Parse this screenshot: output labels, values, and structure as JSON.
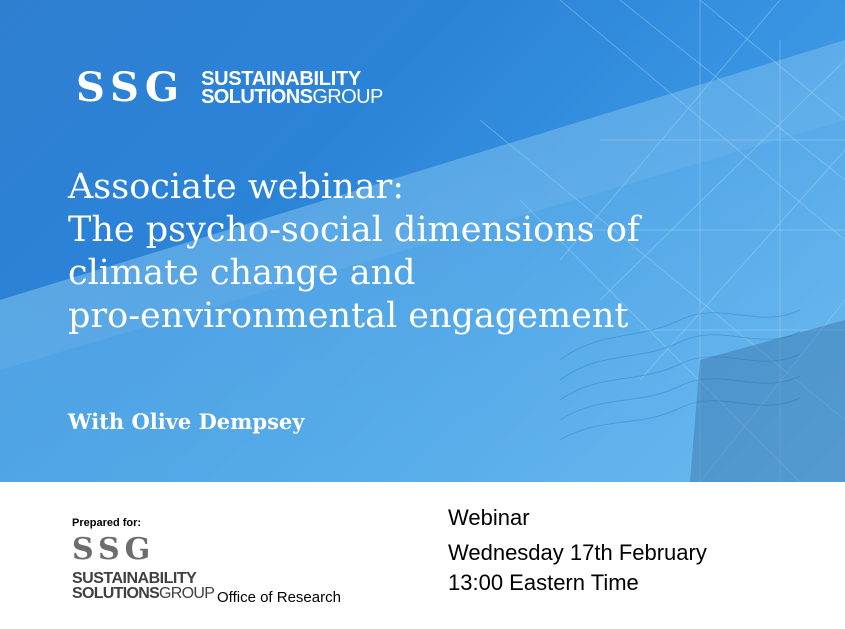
{
  "hero": {
    "logo": {
      "mark": "SSG",
      "line1": "SUSTAINABILITY",
      "line2_bold": "SOLUTIONS",
      "line2_light": "GROUP"
    },
    "title_lines": [
      "Associate webinar:",
      "The psycho-social dimensions of",
      "climate change and",
      "pro-environmental engagement"
    ],
    "presenter": "With Olive Dempsey"
  },
  "footer": {
    "prepared_for": "Prepared for:",
    "logo": {
      "mark": "SSG",
      "line1": "SUSTAINABILITY",
      "line2_bold": "SOLUTIONS",
      "line2_light": "GROUP"
    },
    "office": "Office of Research",
    "event_type": "Webinar",
    "date": "Wednesday 17th February",
    "time": "13:00 Eastern Time"
  },
  "colors": {
    "hero_blue": "#2b83d8",
    "text_light": "#ffffff",
    "logo_gray": "#6d6d6d"
  }
}
